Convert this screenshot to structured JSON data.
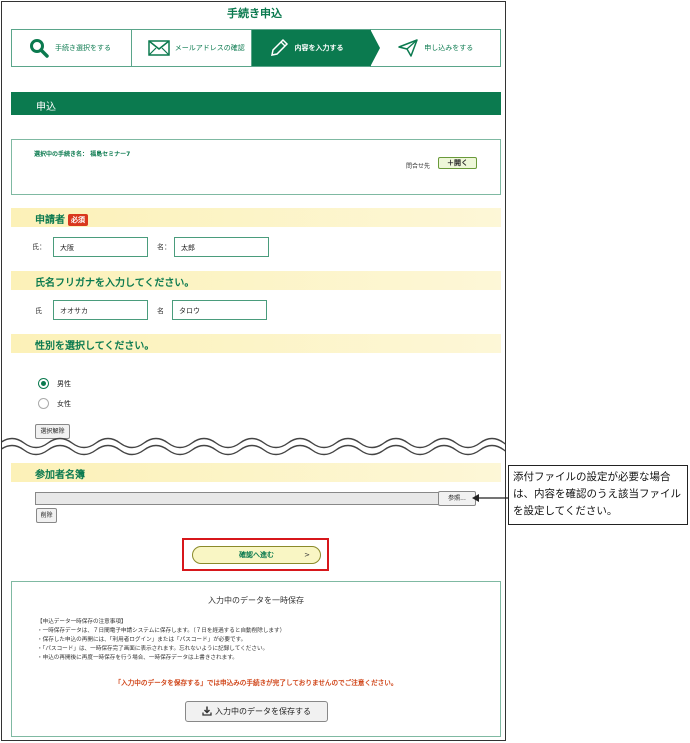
{
  "page_title": "手続き申込",
  "steps": [
    {
      "label": "手続き選択をする",
      "icon": "search-icon",
      "active": false
    },
    {
      "label": "メールアドレスの確認",
      "icon": "mail-icon",
      "active": false
    },
    {
      "label": "内容を入力する",
      "icon": "pencil-icon",
      "active": true
    },
    {
      "label": "申し込みをする",
      "icon": "send-icon",
      "active": false
    }
  ],
  "section_title": "申込",
  "procedure": {
    "name_text": "選択中の手続き名：  福島セミナー7",
    "contact_label": "問合せ先",
    "open_button": "＋開く"
  },
  "applicant": {
    "heading": "申請者",
    "required_badge": "必須",
    "last_name_label": "氏：",
    "last_name_value": "大阪",
    "first_name_label": "名：",
    "first_name_value": "太郎"
  },
  "furigana": {
    "heading": "氏名フリガナを入力してください。",
    "last_label": "氏",
    "last_value": "オオサカ",
    "first_label": "名",
    "first_value": "タロウ"
  },
  "gender": {
    "heading": "性別を選択してください。",
    "options": [
      {
        "label": "男性",
        "selected": true
      },
      {
        "label": "女性",
        "selected": false
      }
    ],
    "clear_button": "選択解除"
  },
  "participants": {
    "heading": "参加者名簿",
    "browse_button": "参照...",
    "delete_button": "削除"
  },
  "confirm_button": "確認へ進む",
  "confirm_arrow": ">",
  "temp_save": {
    "title": "入力中のデータを一時保存",
    "notes": [
      "【申込データ一時保存の注意事項】",
      "・一時保存データは、７日間電子申請システムに保存します。（７日を経過すると自動削除します）",
      "・保存した申込の再開には、「利用者ログイン」または「パスコード」が必要です。",
      "・「パスコード」は、一時保存完了画面に表示されます。忘れないように記録してください。",
      "・申込の再開後に再度一時保存を行う場合、一時保存データは上書きされます。"
    ],
    "warning": "「入力中のデータを保存する」では申込みの手続きが完了しておりませんのでご注意ください。",
    "save_button": "入力中のデータを保存する"
  },
  "callout": "添付ファイルの設定が必要な場合は、内容を確認のうえ該当ファイルを設定してください。",
  "colors": {
    "brand_green": "#0b7a4f",
    "required_red": "#d9381e",
    "highlight_red": "#d7171b",
    "warning_orange": "#d0461a"
  }
}
